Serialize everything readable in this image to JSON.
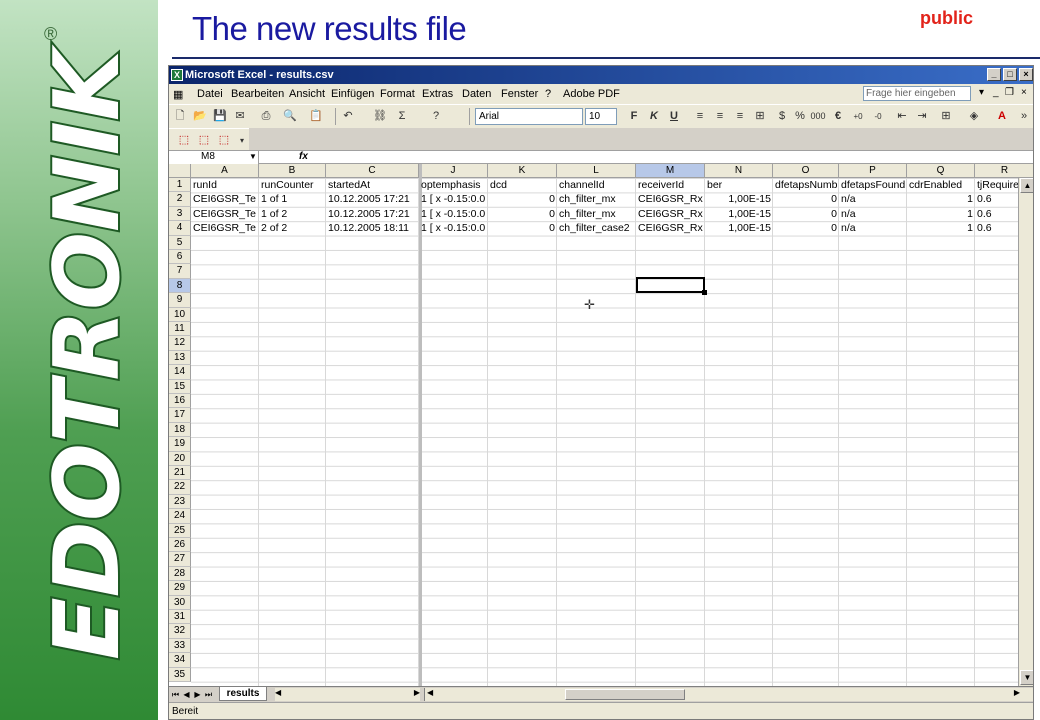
{
  "slide": {
    "title": "The new results file",
    "tag": "public",
    "registered_mark": "®",
    "logo_text": "EDOTRONIK"
  },
  "window": {
    "title": "Microsoft Excel - results.csv",
    "app_icon": "excel-icon",
    "controls": [
      "_",
      "□",
      "×"
    ]
  },
  "menu": {
    "items": [
      "Datei",
      "Bearbeiten",
      "Ansicht",
      "Einfügen",
      "Format",
      "Extras",
      "Daten",
      "Fenster",
      "?",
      "Adobe PDF"
    ],
    "help_placeholder": "Frage hier eingeben"
  },
  "toolbar": {
    "font": "Arial",
    "font_size": "10",
    "bold": "F",
    "italic": "K",
    "underline": "U",
    "sum": "Σ",
    "percent": "%",
    "thousands": "000",
    "euro": "€"
  },
  "formula_bar": {
    "name_box": "M8",
    "fx": "fx",
    "content": ""
  },
  "grid": {
    "column_headers": [
      "A",
      "B",
      "C",
      "J",
      "K",
      "L",
      "M",
      "N",
      "O",
      "P",
      "Q",
      "R"
    ],
    "selected_column": "M",
    "selected_row": "8",
    "row_headers": [
      "1",
      "2",
      "3",
      "4",
      "5",
      "6",
      "7",
      "8",
      "9",
      "10",
      "11",
      "12",
      "13",
      "14",
      "15",
      "16",
      "17",
      "18",
      "19",
      "20",
      "21",
      "22",
      "23",
      "24",
      "25",
      "26",
      "27",
      "28",
      "29",
      "30",
      "31",
      "32",
      "33",
      "34",
      "35"
    ],
    "rows": [
      [
        "runId",
        "runCounter",
        "startedAt",
        "optemphasis",
        "dcd",
        "channelId",
        "receiverId",
        "ber",
        "dfetapsNumb",
        "dfetapsFound",
        "cdrEnabled",
        "tjRequire"
      ],
      [
        "CEI6GSR_Te",
        "1 of 1",
        "10.12.2005 17:21",
        "1  [ x -0.15:0.0",
        "0",
        "ch_filter_mx",
        "CEI6GSR_Rx",
        "1,00E-15",
        "0",
        "n/a",
        "1",
        "0.6"
      ],
      [
        "CEI6GSR_Te",
        "1 of 2",
        "10.12.2005 17:21",
        "1  [ x -0.15:0.0",
        "0",
        "ch_filter_mx",
        "CEI6GSR_Rx",
        "1,00E-15",
        "0",
        "n/a",
        "1",
        "0.6"
      ],
      [
        "CEI6GSR_Te",
        "2 of 2",
        "10.12.2005 18:11",
        "1  [ x -0.15:0.0",
        "0",
        "ch_filter_case2",
        "CEI6GSR_Rx",
        "1,00E-15",
        "0",
        "n/a",
        "1",
        "0.6"
      ]
    ]
  },
  "sheet_tabs": {
    "active": "results"
  },
  "status": {
    "text": "Bereit"
  }
}
